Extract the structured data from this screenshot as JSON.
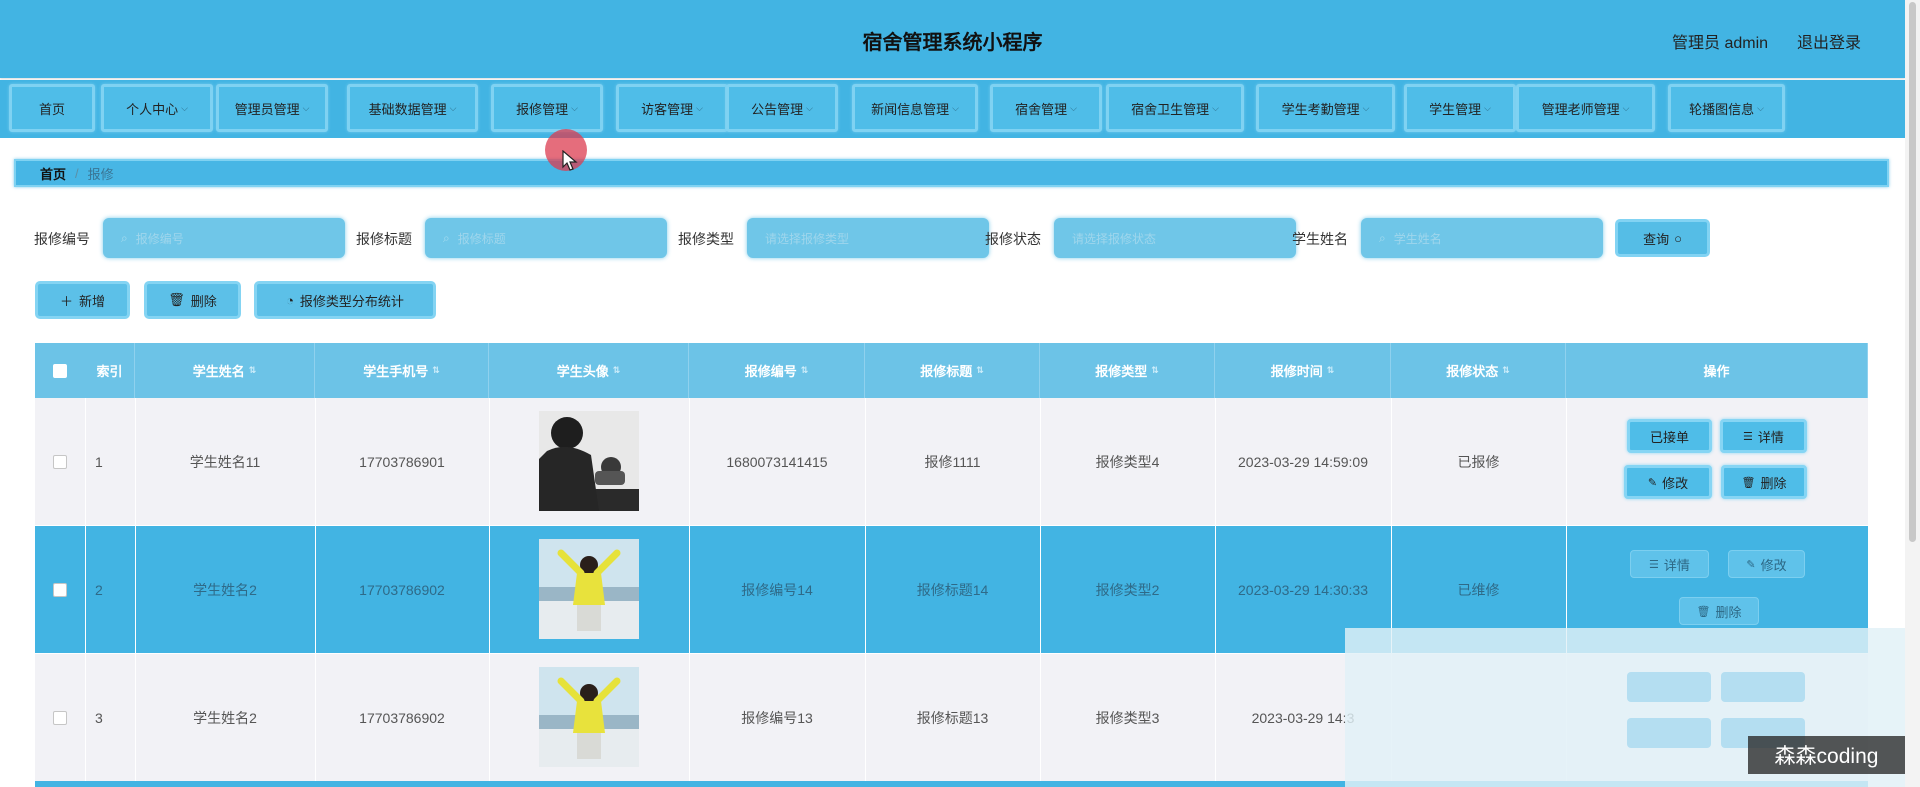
{
  "header": {
    "title": "宿舍管理系统小程序",
    "user": "管理员 admin",
    "logout": "退出登录"
  },
  "nav": [
    {
      "label": "首页",
      "has_menu": false
    },
    {
      "label": "个人中心",
      "has_menu": true
    },
    {
      "label": "管理员管理",
      "has_menu": true
    },
    {
      "label": "基础数据管理",
      "has_menu": true
    },
    {
      "label": "报修管理",
      "has_menu": true
    },
    {
      "label": "访客管理",
      "has_menu": true
    },
    {
      "label": "公告管理",
      "has_menu": true
    },
    {
      "label": "新闻信息管理",
      "has_menu": true
    },
    {
      "label": "宿舍管理",
      "has_menu": true
    },
    {
      "label": "宿舍卫生管理",
      "has_menu": true
    },
    {
      "label": "学生考勤管理",
      "has_menu": true
    },
    {
      "label": "学生管理",
      "has_menu": true
    },
    {
      "label": "管理老师管理",
      "has_menu": true
    },
    {
      "label": "轮播图信息",
      "has_menu": true
    }
  ],
  "breadcrumb": {
    "home": "首页",
    "sep": "/",
    "current": "报修"
  },
  "search": {
    "fields": [
      {
        "label": "报修编号",
        "placeholder": "报修编号"
      },
      {
        "label": "报修标题",
        "placeholder": "报修标题"
      },
      {
        "label": "报修类型",
        "placeholder": "请选择报修类型"
      },
      {
        "label": "报修状态",
        "placeholder": "请选择报修状态"
      },
      {
        "label": "学生姓名",
        "placeholder": "学生姓名"
      }
    ],
    "query_label": "查询"
  },
  "actions": {
    "add": "新增",
    "delete": "删除",
    "stats": "报修类型分布统计"
  },
  "table": {
    "headers": [
      "索引",
      "学生姓名",
      "学生手机号",
      "学生头像",
      "报修编号",
      "报修标题",
      "报修类型",
      "报修时间",
      "报修状态",
      "操作"
    ],
    "rows": [
      {
        "index": "1",
        "name": "学生姓名11",
        "phone": "17703786901",
        "avatar": "photo-man-icon",
        "code": "1680073141415",
        "title": "报修1111",
        "type": "报修类型4",
        "time": "2023-03-29 14:59:09",
        "status": "已报修",
        "ops": [
          "已接单",
          "详情",
          "修改",
          "删除"
        ]
      },
      {
        "index": "2",
        "name": "学生姓名2",
        "phone": "17703786902",
        "avatar": "photo-woman-icon",
        "code": "报修编号14",
        "title": "报修标题14",
        "type": "报修类型2",
        "time": "2023-03-29 14:30:33",
        "status": "已维修",
        "ops": [
          "详情",
          "修改",
          "删除"
        ]
      },
      {
        "index": "3",
        "name": "学生姓名2",
        "phone": "17703786902",
        "avatar": "photo-woman-icon",
        "code": "报修编号13",
        "title": "报修标题13",
        "type": "报修类型3",
        "time": "2023-03-29 14:3",
        "status": "",
        "ops": []
      }
    ]
  },
  "watermark": "森森coding",
  "colors": {
    "primary": "#42b4e3",
    "header_row": "#6cc3e7",
    "row_gray": "#f2f2f6",
    "cursor": "#dc3c50"
  }
}
